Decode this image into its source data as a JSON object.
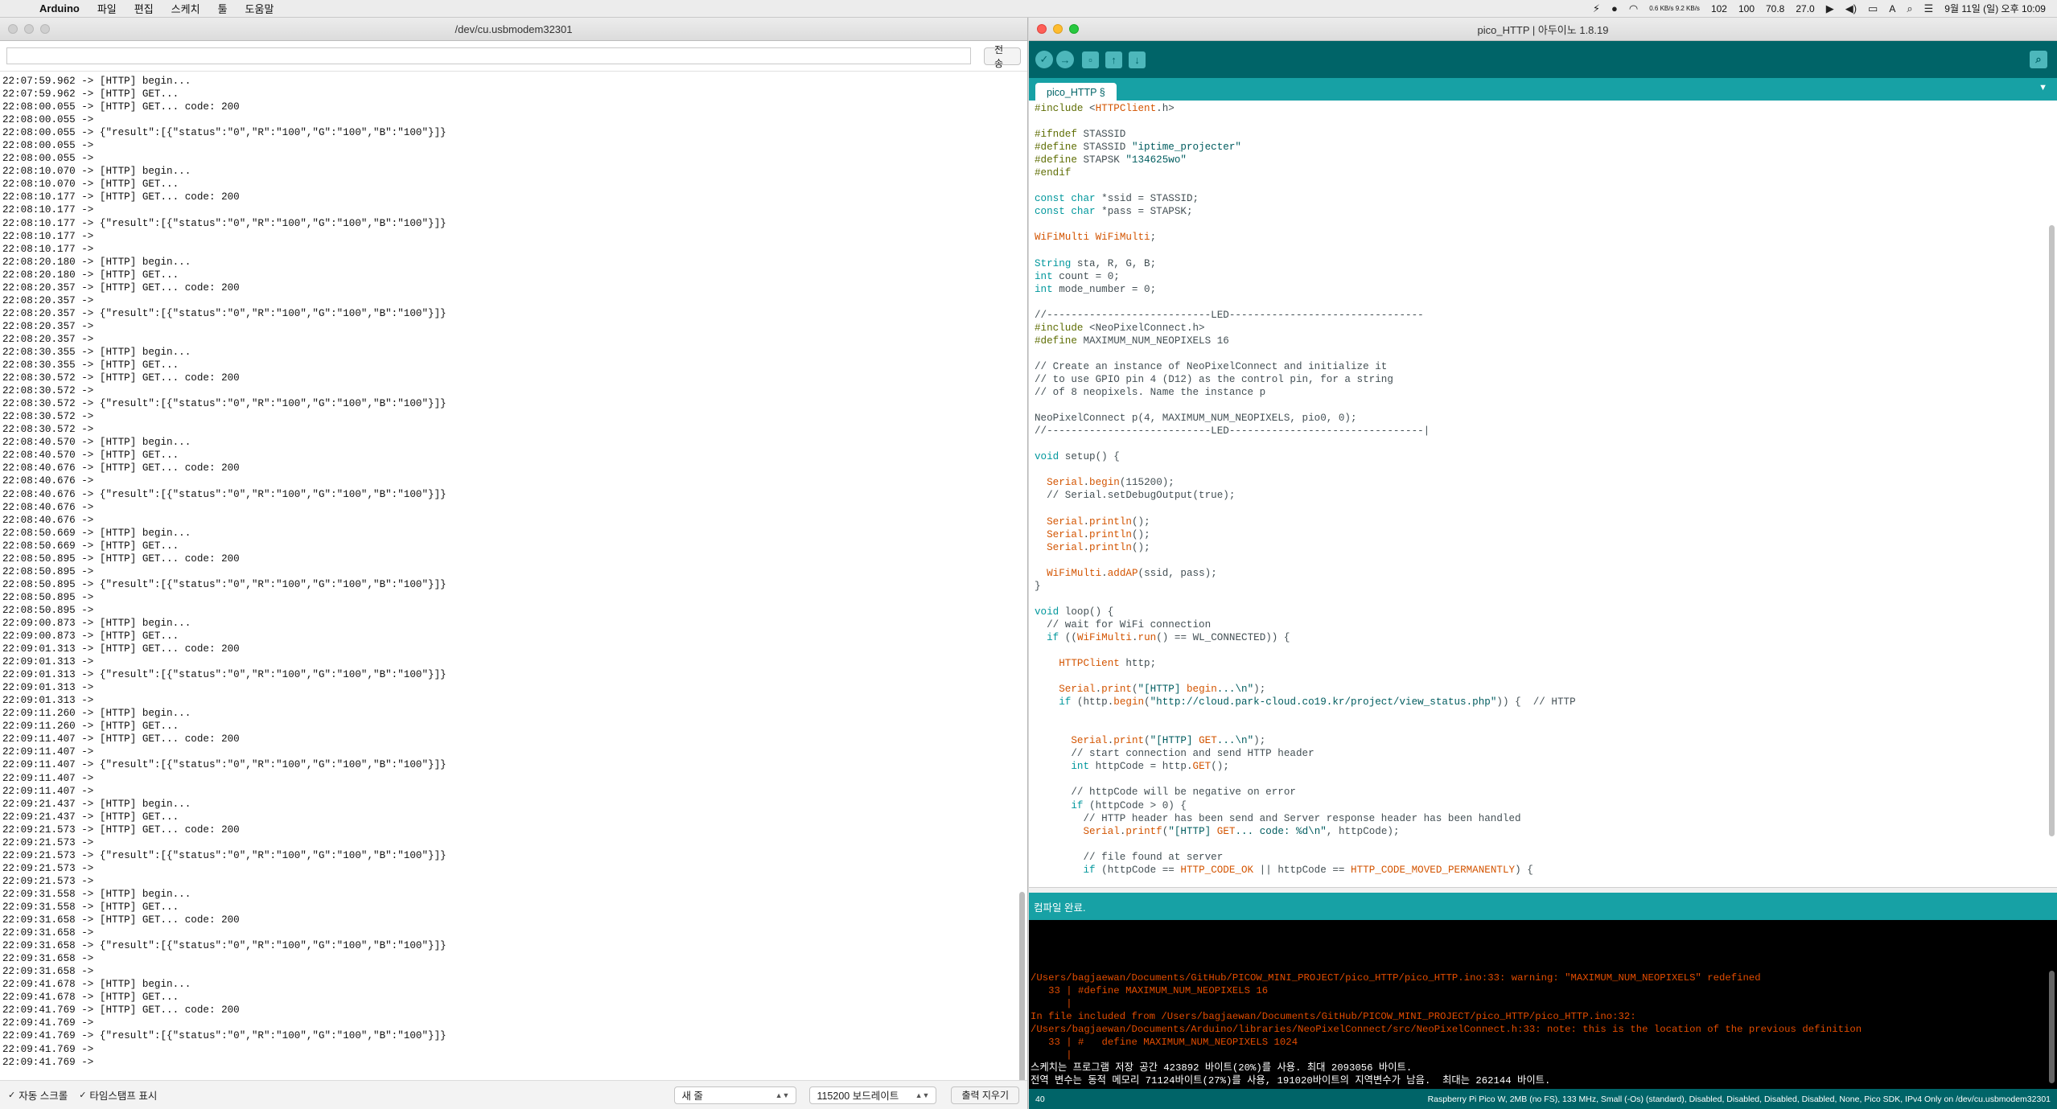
{
  "menubar": {
    "app_name": "Arduino",
    "items": [
      "파일",
      "편집",
      "스케치",
      "툴",
      "도움말"
    ],
    "status": {
      "net_speed": "0.6 KB/s 9.2 KB/s",
      "memory": "102",
      "cpu": "100",
      "battery_pct": "70.8",
      "temp": "27.0",
      "input_source": "A",
      "datetime": "9월 11일 (일) 오후 10:09"
    }
  },
  "serial": {
    "window_title": "/dev/cu.usbmodem32301",
    "send_label": "전송",
    "lines": [
      "22:07:59.962 -> [HTTP] begin...",
      "22:07:59.962 -> [HTTP] GET...",
      "22:08:00.055 -> [HTTP] GET... code: 200",
      "22:08:00.055 ->",
      "22:08:00.055 -> {\"result\":[{\"status\":\"0\",\"R\":\"100\",\"G\":\"100\",\"B\":\"100\"}]}",
      "22:08:00.055 ->",
      "22:08:00.055 ->",
      "22:08:10.070 -> [HTTP] begin...",
      "22:08:10.070 -> [HTTP] GET...",
      "22:08:10.177 -> [HTTP] GET... code: 200",
      "22:08:10.177 ->",
      "22:08:10.177 -> {\"result\":[{\"status\":\"0\",\"R\":\"100\",\"G\":\"100\",\"B\":\"100\"}]}",
      "22:08:10.177 ->",
      "22:08:10.177 ->",
      "22:08:20.180 -> [HTTP] begin...",
      "22:08:20.180 -> [HTTP] GET...",
      "22:08:20.357 -> [HTTP] GET... code: 200",
      "22:08:20.357 ->",
      "22:08:20.357 -> {\"result\":[{\"status\":\"0\",\"R\":\"100\",\"G\":\"100\",\"B\":\"100\"}]}",
      "22:08:20.357 ->",
      "22:08:20.357 ->",
      "22:08:30.355 -> [HTTP] begin...",
      "22:08:30.355 -> [HTTP] GET...",
      "22:08:30.572 -> [HTTP] GET... code: 200",
      "22:08:30.572 ->",
      "22:08:30.572 -> {\"result\":[{\"status\":\"0\",\"R\":\"100\",\"G\":\"100\",\"B\":\"100\"}]}",
      "22:08:30.572 ->",
      "22:08:30.572 ->",
      "22:08:40.570 -> [HTTP] begin...",
      "22:08:40.570 -> [HTTP] GET...",
      "22:08:40.676 -> [HTTP] GET... code: 200",
      "22:08:40.676 ->",
      "22:08:40.676 -> {\"result\":[{\"status\":\"0\",\"R\":\"100\",\"G\":\"100\",\"B\":\"100\"}]}",
      "22:08:40.676 ->",
      "22:08:40.676 ->",
      "22:08:50.669 -> [HTTP] begin...",
      "22:08:50.669 -> [HTTP] GET...",
      "22:08:50.895 -> [HTTP] GET... code: 200",
      "22:08:50.895 ->",
      "22:08:50.895 -> {\"result\":[{\"status\":\"0\",\"R\":\"100\",\"G\":\"100\",\"B\":\"100\"}]}",
      "22:08:50.895 ->",
      "22:08:50.895 ->",
      "22:09:00.873 -> [HTTP] begin...",
      "22:09:00.873 -> [HTTP] GET...",
      "22:09:01.313 -> [HTTP] GET... code: 200",
      "22:09:01.313 ->",
      "22:09:01.313 -> {\"result\":[{\"status\":\"0\",\"R\":\"100\",\"G\":\"100\",\"B\":\"100\"}]}",
      "22:09:01.313 ->",
      "22:09:01.313 ->",
      "22:09:11.260 -> [HTTP] begin...",
      "22:09:11.260 -> [HTTP] GET...",
      "22:09:11.407 -> [HTTP] GET... code: 200",
      "22:09:11.407 ->",
      "22:09:11.407 -> {\"result\":[{\"status\":\"0\",\"R\":\"100\",\"G\":\"100\",\"B\":\"100\"}]}",
      "22:09:11.407 ->",
      "22:09:11.407 ->",
      "22:09:21.437 -> [HTTP] begin...",
      "22:09:21.437 -> [HTTP] GET...",
      "22:09:21.573 -> [HTTP] GET... code: 200",
      "22:09:21.573 ->",
      "22:09:21.573 -> {\"result\":[{\"status\":\"0\",\"R\":\"100\",\"G\":\"100\",\"B\":\"100\"}]}",
      "22:09:21.573 ->",
      "22:09:21.573 ->",
      "22:09:31.558 -> [HTTP] begin...",
      "22:09:31.558 -> [HTTP] GET...",
      "22:09:31.658 -> [HTTP] GET... code: 200",
      "22:09:31.658 ->",
      "22:09:31.658 -> {\"result\":[{\"status\":\"0\",\"R\":\"100\",\"G\":\"100\",\"B\":\"100\"}]}",
      "22:09:31.658 ->",
      "22:09:31.658 ->",
      "22:09:41.678 -> [HTTP] begin...",
      "22:09:41.678 -> [HTTP] GET...",
      "22:09:41.769 -> [HTTP] GET... code: 200",
      "22:09:41.769 ->",
      "22:09:41.769 -> {\"result\":[{\"status\":\"0\",\"R\":\"100\",\"G\":\"100\",\"B\":\"100\"}]}",
      "22:09:41.769 ->",
      "22:09:41.769 ->"
    ],
    "footer": {
      "autoscroll_label": "자동 스크롤",
      "timestamp_label": "타임스탬프 표시",
      "line_ending": "새 줄",
      "baud_rate": "115200 보드레이트",
      "clear_label": "출력 지우기"
    }
  },
  "ide": {
    "window_title": "pico_HTTP | 아두이노 1.8.19",
    "tab_label": "pico_HTTP §",
    "code_lines": [
      "#include <HTTPClient.h>",
      "",
      "#ifndef STASSID",
      "#define STASSID \"iptime_projecter\"",
      "#define STAPSK \"134625wo\"",
      "#endif",
      "",
      "const char *ssid = STASSID;",
      "const char *pass = STAPSK;",
      "",
      "WiFiMulti WiFiMulti;",
      "",
      "String sta, R, G, B;",
      "int count = 0;",
      "int mode_number = 0;",
      "",
      "//---------------------------LED--------------------------------",
      "#include <NeoPixelConnect.h>",
      "#define MAXIMUM_NUM_NEOPIXELS 16",
      "",
      "// Create an instance of NeoPixelConnect and initialize it",
      "// to use GPIO pin 4 (D12) as the control pin, for a string",
      "// of 8 neopixels. Name the instance p",
      "",
      "NeoPixelConnect p(4, MAXIMUM_NUM_NEOPIXELS, pio0, 0);",
      "//---------------------------LED--------------------------------|",
      "",
      "void setup() {",
      "",
      "  Serial.begin(115200);",
      "  // Serial.setDebugOutput(true);",
      "",
      "  Serial.println();",
      "  Serial.println();",
      "  Serial.println();",
      "",
      "  WiFiMulti.addAP(ssid, pass);",
      "}",
      "",
      "void loop() {",
      "  // wait for WiFi connection",
      "  if ((WiFiMulti.run() == WL_CONNECTED)) {",
      "",
      "    HTTPClient http;",
      "",
      "    Serial.print(\"[HTTP] begin...\\n\");",
      "    if (http.begin(\"http://cloud.park-cloud.co19.kr/project/view_status.php\")) {  // HTTP",
      "",
      "",
      "      Serial.print(\"[HTTP] GET...\\n\");",
      "      // start connection and send HTTP header",
      "      int httpCode = http.GET();",
      "",
      "      // httpCode will be negative on error",
      "      if (httpCode > 0) {",
      "        // HTTP header has been send and Server response header has been handled",
      "        Serial.printf(\"[HTTP] GET... code: %d\\n\", httpCode);",
      "",
      "        // file found at server",
      "        if (httpCode == HTTP_CODE_OK || httpCode == HTTP_CODE_MOVED_PERMANENTLY) {"
    ],
    "status_message": "컴파일 완료.",
    "console_lines": [
      {
        "text": "",
        "color": "orange"
      },
      {
        "text": "",
        "color": "orange"
      },
      {
        "text": "",
        "color": "orange"
      },
      {
        "text": "",
        "color": "orange"
      },
      {
        "text": "/Users/bagjaewan/Documents/GitHub/PICOW_MINI_PROJECT/pico_HTTP/pico_HTTP.ino:33: warning: \"MAXIMUM_NUM_NEOPIXELS\" redefined",
        "color": "orange"
      },
      {
        "text": "   33 | #define MAXIMUM_NUM_NEOPIXELS 16",
        "color": "orange"
      },
      {
        "text": "      |",
        "color": "orange"
      },
      {
        "text": "In file included from /Users/bagjaewan/Documents/GitHub/PICOW_MINI_PROJECT/pico_HTTP/pico_HTTP.ino:32:",
        "color": "orange"
      },
      {
        "text": "/Users/bagjaewan/Documents/Arduino/libraries/NeoPixelConnect/src/NeoPixelConnect.h:33: note: this is the location of the previous definition",
        "color": "orange"
      },
      {
        "text": "   33 | #   define MAXIMUM_NUM_NEOPIXELS 1024",
        "color": "orange"
      },
      {
        "text": "      |",
        "color": "orange"
      },
      {
        "text": "스케치는 프로그램 저장 공간 423892 바이트(20%)를 사용. 최대 2093056 바이트.",
        "color": "white"
      },
      {
        "text": "전역 변수는 동적 메모리 71124바이트(27%)를 사용, 191020바이트의 지역변수가 남음.  최대는 262144 바이트.",
        "color": "white"
      }
    ],
    "line_number": "40",
    "board_info": "Raspberry Pi Pico W, 2MB (no FS), 133 MHz, Small (-Os) (standard), Disabled, Disabled, Disabled, Disabled, None, Pico SDK, IPv4 Only on /dev/cu.usbmodem32301"
  },
  "colors": {
    "ide_dark_teal": "#006468",
    "ide_teal": "#17a1a5",
    "console_orange": "#e34c00"
  }
}
